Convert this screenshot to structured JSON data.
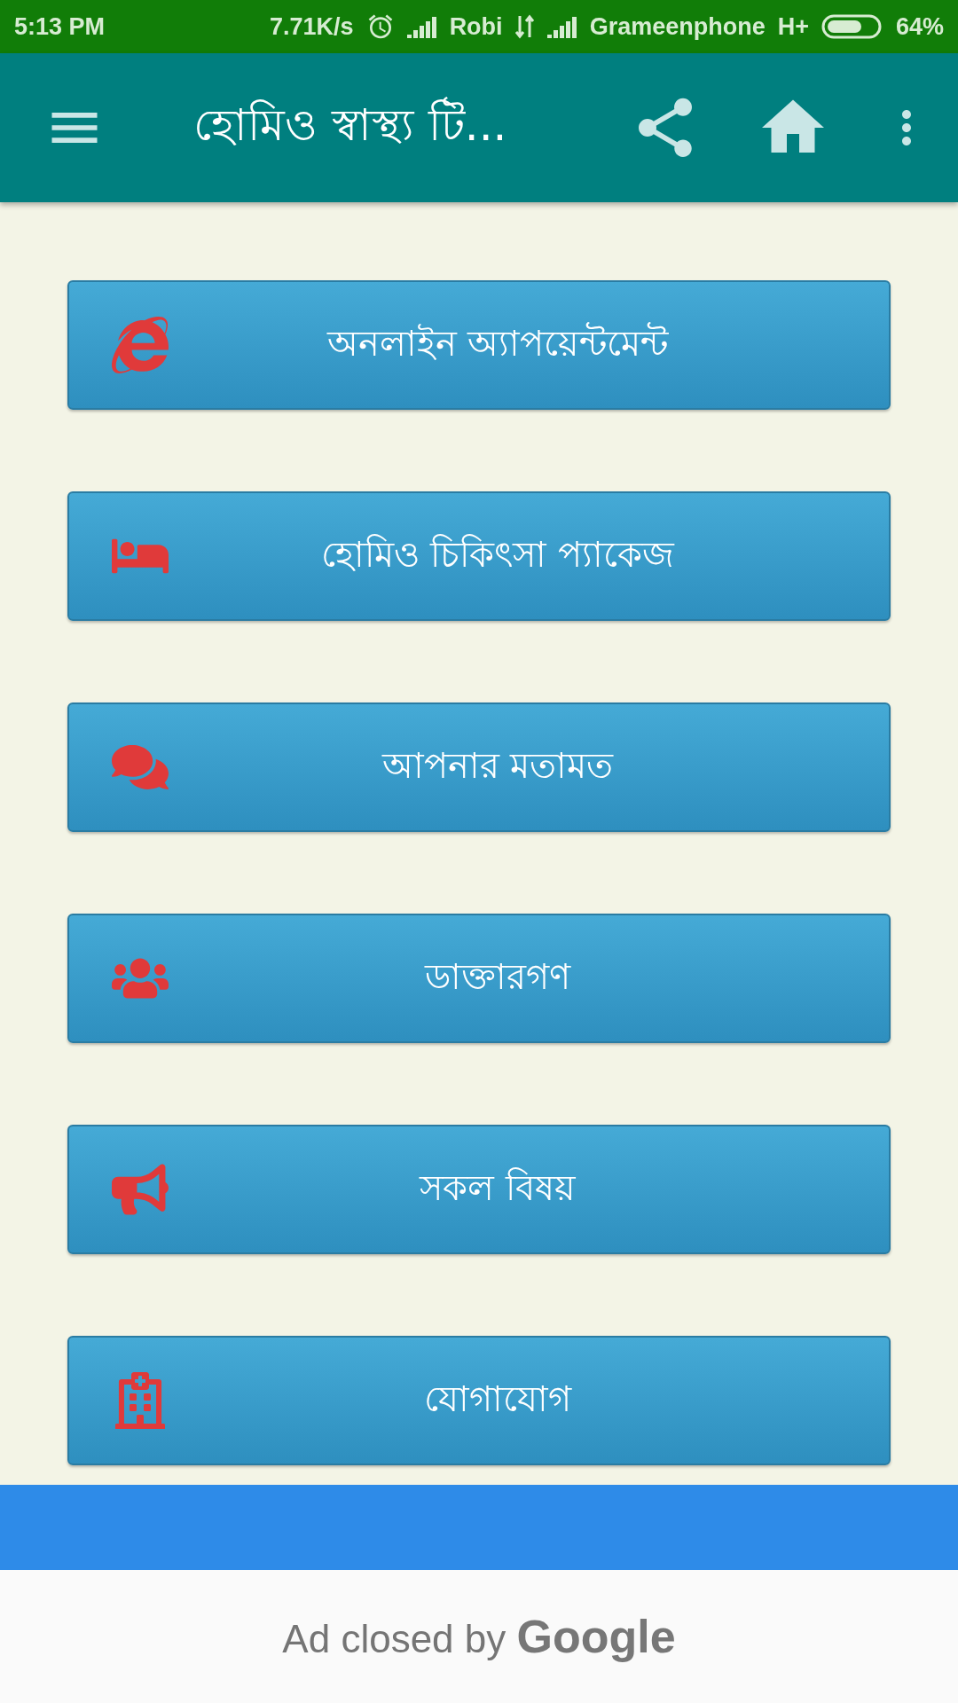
{
  "status_bar": {
    "time": "5:13 PM",
    "speed": "7.71K/s",
    "carrier_1": "Robi",
    "carrier_2": "Grameenphone",
    "network": "H+",
    "battery": "64%"
  },
  "app_bar": {
    "title": "হোমিও স্বাস্থ্য টি..."
  },
  "menu_buttons": [
    {
      "label": "অনলাইন অ্যাপয়েন্টমেন্ট",
      "kind": "browser"
    },
    {
      "label": "হোমিও চিকিৎসা প্যাকেজ",
      "kind": "bed"
    },
    {
      "label": "আপনার মতামত",
      "kind": "comments"
    },
    {
      "label": "ডাক্তারগণ",
      "kind": "users"
    },
    {
      "label": "সকল বিষয়",
      "kind": "bullhorn"
    },
    {
      "label": "যোগাযোগ",
      "kind": "hospital"
    }
  ],
  "ad": {
    "text": "Ad closed by **Google**"
  }
}
